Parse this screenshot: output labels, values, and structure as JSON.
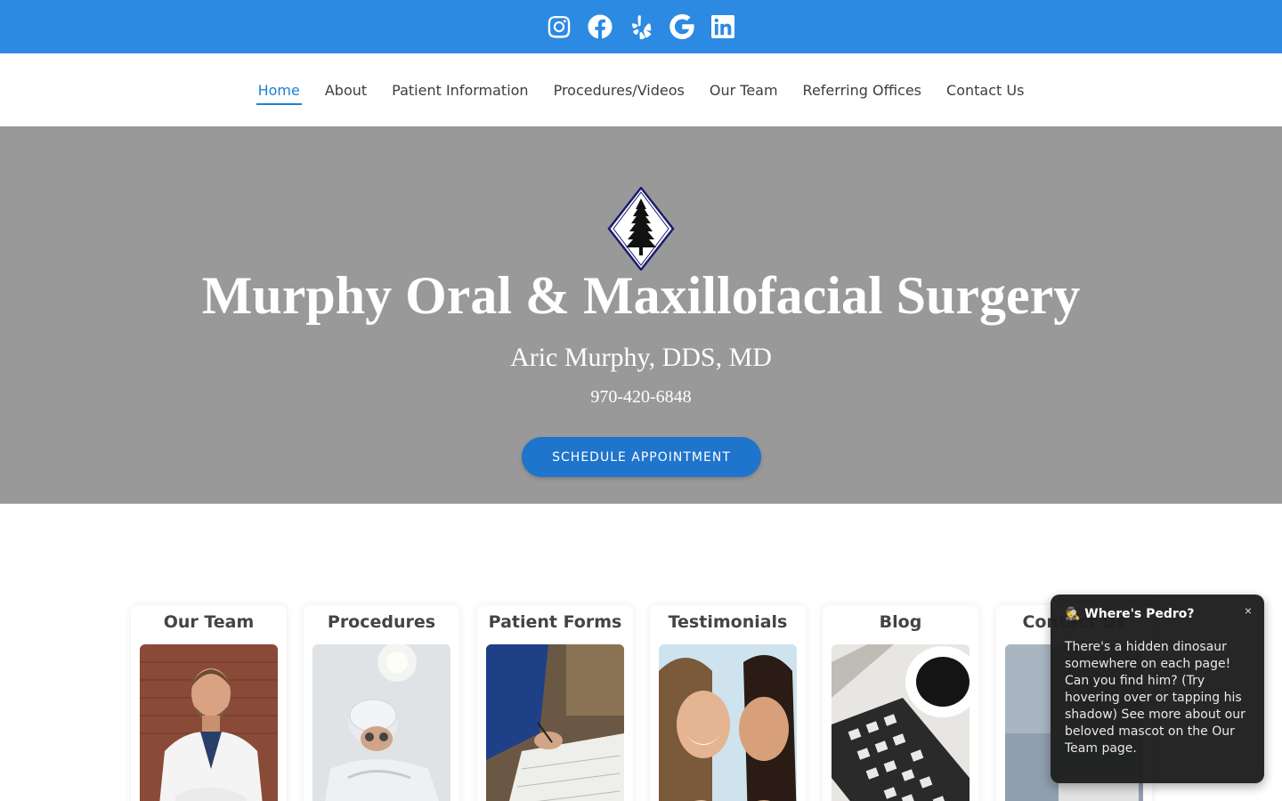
{
  "social": {
    "icons": [
      "instagram-icon",
      "facebook-icon",
      "yelp-icon",
      "google-icon",
      "linkedin-icon"
    ],
    "bar_color": "#2d8ae2"
  },
  "nav": {
    "items": [
      "Home",
      "About",
      "Patient Information",
      "Procedures/Videos",
      "Our Team",
      "Referring Offices",
      "Contact Us"
    ],
    "active": "Home",
    "accent": "#1f7fd1"
  },
  "hero": {
    "title": "Murphy Oral & Maxillofacial Surgery",
    "subtitle": "Aric Murphy, DDS, MD",
    "phone": "970-420-6848",
    "cta_label": "SCHEDULE APPOINTMENT",
    "background": "#999999",
    "logo_icon": "pine-tree-diamond-logo"
  },
  "cards": [
    {
      "title": "Our Team",
      "image": "surgeon-portrait-photo"
    },
    {
      "title": "Procedures",
      "image": "surgeon-operating-photo"
    },
    {
      "title": "Patient Forms",
      "image": "signing-paperwork-photo"
    },
    {
      "title": "Testimonials",
      "image": "smiling-women-photo"
    },
    {
      "title": "Blog",
      "image": "keyboard-coffee-photo"
    },
    {
      "title": "Contact Us",
      "image": "office-photo"
    }
  ],
  "popup": {
    "title": "🕵️ Where's Pedro?",
    "close": "×",
    "body": "There's a hidden dinosaur somewhere on each page! Can you find him? (Try hovering over or tapping his shadow) See more about our beloved mascot on the Our Team page."
  }
}
